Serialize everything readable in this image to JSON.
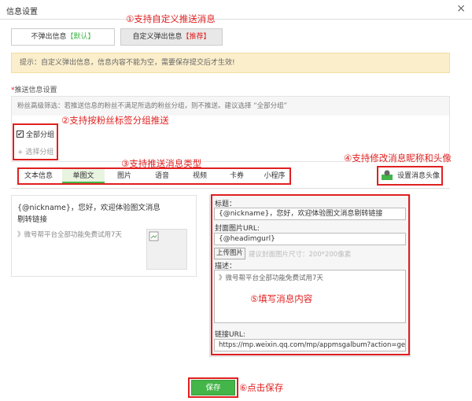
{
  "dialog": {
    "title": "信息设置",
    "close_icon": "×"
  },
  "annotations": {
    "a1": "①支持自定义推送消息",
    "a2": "②支持按粉丝标签分组推送",
    "a3": "③支持推送消息类型",
    "a4": "④支持修改消息昵称和头像",
    "a5": "⑤填写消息内容",
    "a6": "⑥点击保存"
  },
  "mode_tabs": [
    {
      "label": "不弹出信息",
      "tag": "【默认】"
    },
    {
      "label": "自定义弹出信息",
      "tag": "【推荐】"
    }
  ],
  "tip": "提示：自定义弹出信息，信息内容不能为空，需要保存提交后才生效!",
  "push_section": {
    "required_mark": "*",
    "label": "推送信息设置",
    "fans_desc": "粉丝高级筛选：若推送信息的粉丝不满足所选的粉丝分组，则不推送。建议选择 “全部分组”",
    "all_groups": "全部分组",
    "choose_group": "+ 选择分组"
  },
  "message_types": [
    "文本信息",
    "单图文",
    "图片",
    "语音",
    "视频",
    "卡券",
    "小程序"
  ],
  "set_avatar": "设置消息头像",
  "preview": {
    "text": "{@nickname}，您好，欢迎体验图文消息剔转链接",
    "desc": "》微号帮平台全部功能免费试用7天"
  },
  "form": {
    "title_label": "标题：",
    "title_value": "{@nickname}，您好，欢迎体验图文消息剔转链接",
    "cover_label": "封面图片URL:",
    "cover_value": "{@headimgurl}",
    "upload_btn": "上传图片",
    "upload_hint": "建议封面图片尺寸：200*200像素",
    "desc_label": "描述：",
    "desc_value": "》微号帮平台全部功能免费试用7天",
    "link_label": "链接URL:",
    "link_value": "https://mp.weixin.qq.com/mp/appmsgalbum?action=getalbu"
  },
  "save_label": "保存",
  "colors": {
    "accent_green": "#44b549",
    "annotation_red": "#e02020",
    "tip_bg": "#fbeecb"
  }
}
